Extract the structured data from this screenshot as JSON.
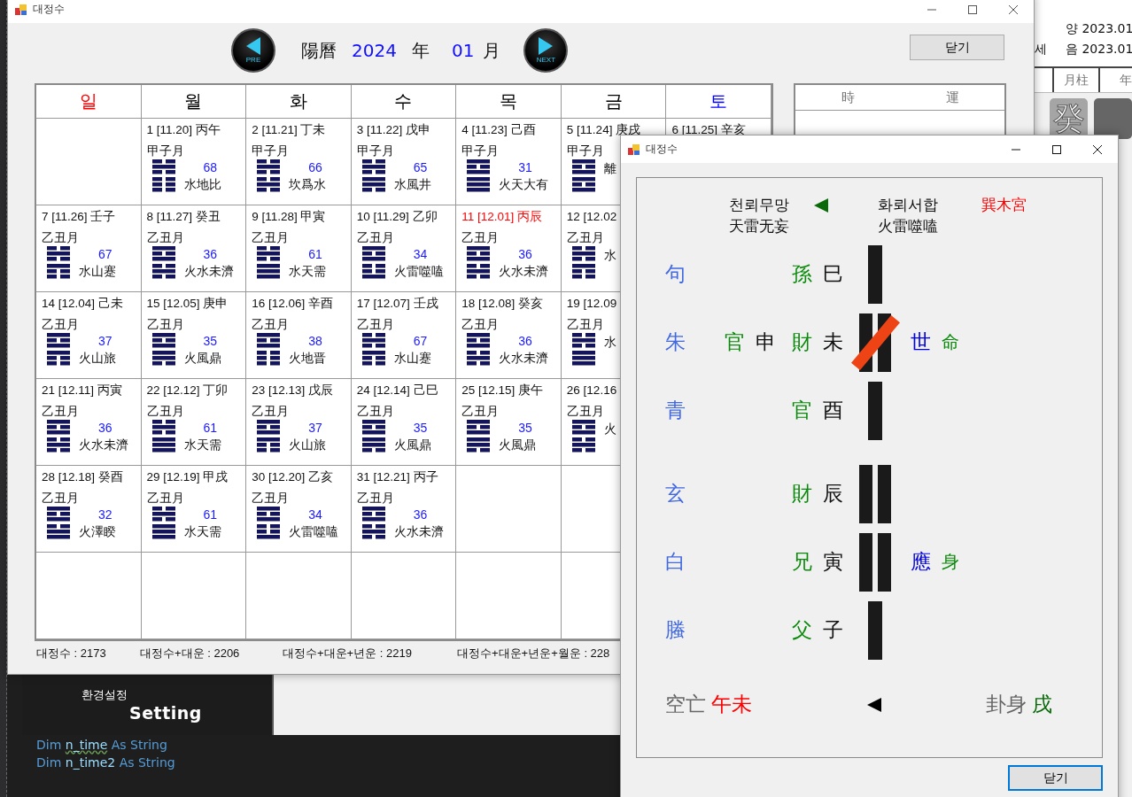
{
  "ide": {
    "settings_panel": {
      "korean": "환경설정",
      "english": "Setting"
    },
    "code_lines": [
      [
        {
          "text": "Dim",
          "kind": "keyword",
          "squiggle": false
        },
        {
          "text": "n_time",
          "kind": "name",
          "squiggle": true
        },
        {
          "text": "As String",
          "kind": "keyword",
          "squiggle": false
        }
      ],
      [
        {
          "text": "Dim",
          "kind": "keyword",
          "squiggle": false
        },
        {
          "text": "n_time2",
          "kind": "name",
          "squiggle": false
        },
        {
          "text": "As String",
          "kind": "keyword",
          "squiggle": false
        }
      ]
    ]
  },
  "background_window": {
    "solar": "양 2023.01",
    "label": "세",
    "lunar": "음 2023.01",
    "columns": [
      "月柱",
      "年"
    ],
    "tiles": [
      {
        "dark": false,
        "text": "癸"
      },
      {
        "dark": true
      }
    ]
  },
  "main_window": {
    "title": "대정수",
    "prev_button": "PRE",
    "next_button": "NEXT",
    "calendar_label": "陽曆",
    "year": "2024",
    "year_unit": "年",
    "month": "01",
    "month_unit": "月",
    "close_button": "닫기",
    "weekdays": [
      {
        "label": "일",
        "color": "#ff0000"
      },
      {
        "label": "월",
        "color": "#000000"
      },
      {
        "label": "화",
        "color": "#000000"
      },
      {
        "label": "수",
        "color": "#000000"
      },
      {
        "label": "목",
        "color": "#000000"
      },
      {
        "label": "금",
        "color": "#000000"
      },
      {
        "label": "토",
        "color": "#0000ff"
      }
    ],
    "weeks": [
      [
        {
          "kind": "blank"
        },
        {
          "kind": "day",
          "date": "1 [11.20] 丙午",
          "holiday": false,
          "month": "甲子月",
          "solid": [
            false,
            true,
            false,
            false,
            false,
            false
          ],
          "number": "68",
          "name": "水地比"
        },
        {
          "kind": "day",
          "date": "2 [11.21] 丁未",
          "holiday": false,
          "month": "甲子月",
          "solid": [
            false,
            true,
            false,
            false,
            true,
            false
          ],
          "number": "66",
          "name": "坎爲水"
        },
        {
          "kind": "day",
          "date": "3 [11.22] 戊申",
          "holiday": false,
          "month": "甲子月",
          "solid": [
            false,
            true,
            false,
            true,
            true,
            false
          ],
          "number": "65",
          "name": "水風井"
        },
        {
          "kind": "day",
          "date": "4 [11.23] 己酉",
          "holiday": false,
          "month": "甲子月",
          "solid": [
            true,
            false,
            true,
            true,
            true,
            true
          ],
          "number": "31",
          "name": "火天大有"
        },
        {
          "kind": "day",
          "date": "5 [11.24] 庚戌",
          "holiday": false,
          "month": "甲子月",
          "solid": [
            true,
            false,
            true,
            true,
            false,
            true
          ],
          "name": "離"
        },
        {
          "kind": "day",
          "date": "6 [11.25] 辛亥",
          "holiday": false
        }
      ],
      [
        {
          "kind": "day",
          "date": "7 [11.26] 壬子",
          "holiday": false,
          "month": "乙丑月",
          "solid": [
            false,
            true,
            false,
            true,
            false,
            false
          ],
          "number": "67",
          "name": "水山蹇"
        },
        {
          "kind": "day",
          "date": "8 [11.27] 癸丑",
          "holiday": false,
          "month": "乙丑月",
          "solid": [
            true,
            false,
            true,
            false,
            true,
            false
          ],
          "number": "36",
          "name": "火水未濟"
        },
        {
          "kind": "day",
          "date": "9 [11.28] 甲寅",
          "holiday": false,
          "month": "乙丑月",
          "solid": [
            false,
            true,
            false,
            true,
            true,
            true
          ],
          "number": "61",
          "name": "水天需"
        },
        {
          "kind": "day",
          "date": "10 [11.29] 乙卯",
          "holiday": false,
          "month": "乙丑月",
          "solid": [
            true,
            false,
            true,
            false,
            false,
            true
          ],
          "number": "34",
          "name": "火雷噬嗑"
        },
        {
          "kind": "day",
          "date": "11 [12.01] 丙辰",
          "holiday": true,
          "month": "乙丑月",
          "solid": [
            true,
            false,
            true,
            false,
            true,
            false
          ],
          "number": "36",
          "name": "火水未濟"
        },
        {
          "kind": "day",
          "date": "12 [12.02",
          "holiday": false,
          "month": "乙丑月",
          "solid": [
            false,
            true,
            false,
            true,
            false,
            false
          ],
          "name": "水"
        }
      ],
      [
        {
          "kind": "day",
          "date": "14 [12.04] 己未",
          "holiday": false,
          "month": "乙丑月",
          "solid": [
            true,
            false,
            true,
            true,
            false,
            false
          ],
          "number": "37",
          "name": "火山旅"
        },
        {
          "kind": "day",
          "date": "15 [12.05] 庚申",
          "holiday": false,
          "month": "乙丑月",
          "solid": [
            true,
            false,
            true,
            true,
            true,
            false
          ],
          "number": "35",
          "name": "火風鼎"
        },
        {
          "kind": "day",
          "date": "16 [12.06] 辛酉",
          "holiday": false,
          "month": "乙丑月",
          "solid": [
            true,
            false,
            true,
            false,
            false,
            false
          ],
          "number": "38",
          "name": "火地晋"
        },
        {
          "kind": "day",
          "date": "17 [12.07] 壬戌",
          "holiday": false,
          "month": "乙丑月",
          "solid": [
            false,
            true,
            false,
            true,
            false,
            false
          ],
          "number": "67",
          "name": "水山蹇"
        },
        {
          "kind": "day",
          "date": "18 [12.08] 癸亥",
          "holiday": false,
          "month": "乙丑月",
          "solid": [
            true,
            false,
            true,
            false,
            true,
            false
          ],
          "number": "36",
          "name": "火水未濟"
        },
        {
          "kind": "day",
          "date": "19 [12.09",
          "holiday": false,
          "month": "乙丑月",
          "solid": [
            false,
            true,
            false,
            true,
            true,
            true
          ],
          "name": "水"
        }
      ],
      [
        {
          "kind": "day",
          "date": "21 [12.11] 丙寅",
          "holiday": false,
          "month": "乙丑月",
          "solid": [
            true,
            false,
            true,
            false,
            true,
            false
          ],
          "number": "36",
          "name": "火水未濟"
        },
        {
          "kind": "day",
          "date": "22 [12.12] 丁卯",
          "holiday": false,
          "month": "乙丑月",
          "solid": [
            false,
            true,
            false,
            true,
            true,
            true
          ],
          "number": "61",
          "name": "水天需"
        },
        {
          "kind": "day",
          "date": "23 [12.13] 戊辰",
          "holiday": false,
          "month": "乙丑月",
          "solid": [
            true,
            false,
            true,
            true,
            false,
            false
          ],
          "number": "37",
          "name": "火山旅"
        },
        {
          "kind": "day",
          "date": "24 [12.14] 己巳",
          "holiday": false,
          "month": "乙丑月",
          "solid": [
            true,
            false,
            true,
            true,
            true,
            false
          ],
          "number": "35",
          "name": "火風鼎"
        },
        {
          "kind": "day",
          "date": "25 [12.15] 庚午",
          "holiday": false,
          "month": "乙丑月",
          "solid": [
            true,
            false,
            true,
            true,
            true,
            false
          ],
          "number": "35",
          "name": "火風鼎"
        },
        {
          "kind": "day",
          "date": "26 [12.16",
          "holiday": false,
          "month": "乙丑月",
          "solid": [
            true,
            false,
            true,
            false,
            true,
            false
          ],
          "name": "火"
        }
      ],
      [
        {
          "kind": "day",
          "date": "28 [12.18] 癸酉",
          "holiday": false,
          "month": "乙丑月",
          "solid": [
            true,
            false,
            true,
            false,
            true,
            true
          ],
          "number": "32",
          "name": "火澤睽"
        },
        {
          "kind": "day",
          "date": "29 [12.19] 甲戌",
          "holiday": false,
          "month": "乙丑月",
          "solid": [
            false,
            true,
            false,
            true,
            true,
            true
          ],
          "number": "61",
          "name": "水天需"
        },
        {
          "kind": "day",
          "date": "30 [12.20] 乙亥",
          "holiday": false,
          "month": "乙丑月",
          "solid": [
            true,
            false,
            true,
            false,
            false,
            true
          ],
          "number": "34",
          "name": "火雷噬嗑"
        },
        {
          "kind": "day",
          "date": "31 [12.21] 丙子",
          "holiday": false,
          "month": "乙丑月",
          "solid": [
            true,
            false,
            true,
            false,
            true,
            false
          ],
          "number": "36",
          "name": "火水未濟"
        },
        {
          "kind": "blank"
        },
        {
          "kind": "blank"
        }
      ],
      [
        {
          "kind": "blank"
        },
        {
          "kind": "blank"
        },
        {
          "kind": "blank"
        },
        {
          "kind": "blank"
        },
        {
          "kind": "blank"
        },
        {
          "kind": "blank"
        },
        {
          "kind": "blank"
        }
      ]
    ],
    "side_panel": {
      "headers": [
        "時",
        "運"
      ]
    },
    "totals": [
      "대정수 : 2173",
      "대정수+대운 : 2206",
      "대정수+대운+년운 : 2219",
      "대정수+대운+년운+월운 : 228"
    ]
  },
  "popup": {
    "title": "대정수",
    "original": {
      "korean": "천뢰무망",
      "hanja": "天雷无妄"
    },
    "changed": {
      "korean": "화뢰서합",
      "hanja": "火雷噬嗑"
    },
    "palace": "巽木宮",
    "lines": [
      {
        "spirit": "句",
        "relation": "孫",
        "branch": "巳",
        "solid": true,
        "moving": false
      },
      {
        "spirit": "朱",
        "hidden_relation": "官",
        "hidden_branch": "申",
        "relation": "財",
        "branch": "未",
        "solid": false,
        "moving": true,
        "mark": "世",
        "extra": "命"
      },
      {
        "spirit": "青",
        "relation": "官",
        "branch": "酉",
        "solid": true,
        "moving": false
      },
      {
        "spirit": "玄",
        "relation": "財",
        "branch": "辰",
        "solid": false,
        "moving": false
      },
      {
        "spirit": "白",
        "relation": "兄",
        "branch": "寅",
        "solid": false,
        "moving": false,
        "mark": "應",
        "extra": "身"
      },
      {
        "spirit": "螣",
        "relation": "父",
        "branch": "子",
        "solid": true,
        "moving": false
      }
    ],
    "void_label": "空亡",
    "void_branches": "午未",
    "body_label": "卦身",
    "body_branch": "戌",
    "close_button": "닫기"
  }
}
